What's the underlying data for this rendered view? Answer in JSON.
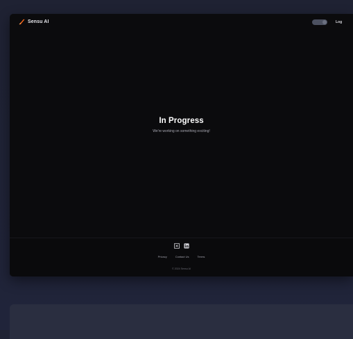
{
  "header": {
    "brand_name": "Sensu AI",
    "brand_icon": "slash-logo-icon",
    "brand_color": "#ff6a1a",
    "login_label": "Log"
  },
  "hero": {
    "title": "In Progress",
    "subtitle": "We're working on something exciting!"
  },
  "footer": {
    "social_icons": [
      "x-icon",
      "linkedin-icon"
    ],
    "links": [
      "Privacy",
      "Contact Us",
      "Terms"
    ],
    "copyright": "© 2024 Sensu AI"
  },
  "colors": {
    "page_background": "#1f2233",
    "window_background": "#0b0b0d",
    "lower_card_background": "#2a2e40"
  }
}
